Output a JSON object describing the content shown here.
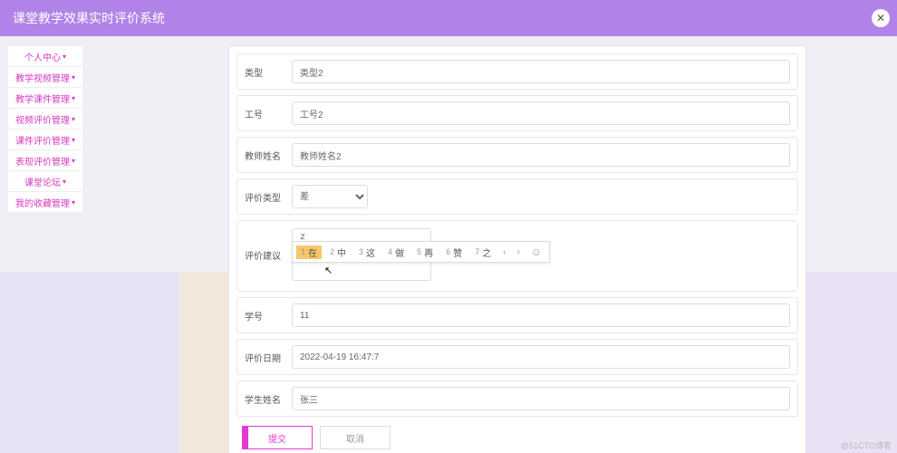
{
  "header": {
    "title": "课堂教学效果实时评价系统"
  },
  "sidebar": {
    "items": [
      {
        "label": "个人中心"
      },
      {
        "label": "教学视频管理"
      },
      {
        "label": "教学课件管理"
      },
      {
        "label": "视频评价管理"
      },
      {
        "label": "课件评价管理"
      },
      {
        "label": "表现评价管理"
      },
      {
        "label": "课堂论坛"
      },
      {
        "label": "我的收藏管理"
      }
    ]
  },
  "form": {
    "type_label": "类型",
    "type_value": "类型2",
    "jobno_label": "工号",
    "jobno_value": "工号2",
    "teacher_label": "教师姓名",
    "teacher_value": "教师姓名2",
    "evaltype_label": "评价类型",
    "evaltype_value": "差",
    "suggest_label": "评价建议",
    "suggest_value": "z",
    "stuno_label": "学号",
    "stuno_value": "11",
    "date_label": "评价日期",
    "date_value": "2022-04-19 16:47:7",
    "stuname_label": "学生姓名",
    "stuname_value": "张三"
  },
  "ime": {
    "candidates": [
      {
        "n": "1",
        "t": "在"
      },
      {
        "n": "2",
        "t": "中"
      },
      {
        "n": "3",
        "t": "这"
      },
      {
        "n": "4",
        "t": "做"
      },
      {
        "n": "5",
        "t": "再"
      },
      {
        "n": "6",
        "t": "赞"
      },
      {
        "n": "7",
        "t": "之"
      }
    ],
    "prev": "‹",
    "next": "›",
    "emoji": "☺"
  },
  "buttons": {
    "submit": "提交",
    "cancel": "取消"
  },
  "watermark": "@51CTO博客"
}
